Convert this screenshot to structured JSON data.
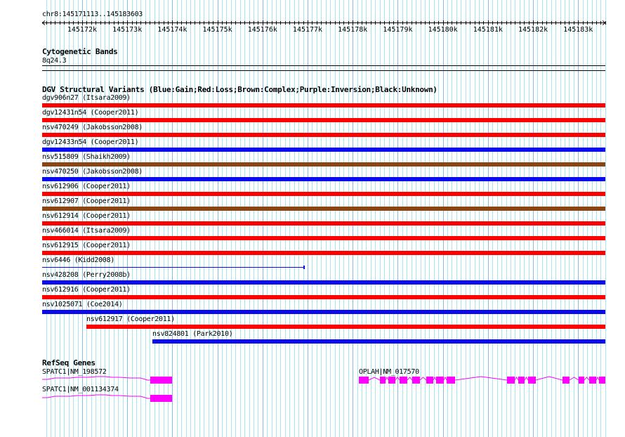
{
  "ruler": {
    "region": "chr8:145171113..145183603",
    "start": 145171113,
    "end": 145183603,
    "tick_labels": [
      "145172k",
      "145173k",
      "145174k",
      "145175k",
      "145176k",
      "145177k",
      "145178k",
      "145179k",
      "145180k",
      "145181k",
      "145182k",
      "145183k"
    ]
  },
  "cytoband": {
    "title": "Cytogenetic Bands",
    "band": "8q24.3"
  },
  "dgv": {
    "title": "DGV Structural Variants (Blue:Gain;Red:Loss;Brown:Complex;Purple:Inversion;Black:Unknown)",
    "colors": {
      "gain": "#0a0af0",
      "loss": "#ff0000",
      "complex": "#8b4513"
    },
    "variants": [
      {
        "label": "dgv906n27 (Itsara2009)",
        "type": "loss",
        "span": "full"
      },
      {
        "label": "dgv12431n54 (Cooper2011)",
        "type": "loss",
        "span": "full"
      },
      {
        "label": "nsv470249 (Jakobsson2008)",
        "type": "loss",
        "span": "full"
      },
      {
        "label": "dgv12433n54 (Cooper2011)",
        "type": "gain",
        "span": "full"
      },
      {
        "label": "nsv515809 (Shaikh2009)",
        "type": "complex",
        "span": "full"
      },
      {
        "label": "nsv470250 (Jakobsson2008)",
        "type": "gain",
        "span": "full"
      },
      {
        "label": "nsv612906 (Cooper2011)",
        "type": "loss",
        "span": "full"
      },
      {
        "label": "nsv612907 (Cooper2011)",
        "type": "complex",
        "span": "full"
      },
      {
        "label": "nsv612914 (Cooper2011)",
        "type": "loss",
        "span": "full"
      },
      {
        "label": "nsv466014 (Itsara2009)",
        "type": "loss",
        "span": "full"
      },
      {
        "label": "nsv612915 (Cooper2011)",
        "type": "loss",
        "span": "full"
      },
      {
        "label": "nsv6446 (Kidd2008)",
        "type": "gain",
        "span": "thin"
      },
      {
        "label": "nsv428208 (Perry2008b)",
        "type": "gain",
        "span": "full"
      },
      {
        "label": "nsv612916 (Cooper2011)",
        "type": "loss",
        "span": "full"
      },
      {
        "label": "nsv1025071 (Coe2014)",
        "type": "gain",
        "span": "full"
      },
      {
        "label": "nsv612917 (Cooper2011)",
        "type": "loss",
        "span": "partial1"
      },
      {
        "label": "nsv824801 (Park2010)",
        "type": "gain",
        "span": "partial2"
      }
    ]
  },
  "refseq": {
    "title": "RefSeq Genes",
    "color": "#ff00ff",
    "genes": [
      {
        "label": "SPATC1|NM_198572"
      },
      {
        "label": "SPATC1|NM_001134374"
      },
      {
        "label": "OPLAH|NM_017570"
      }
    ]
  }
}
